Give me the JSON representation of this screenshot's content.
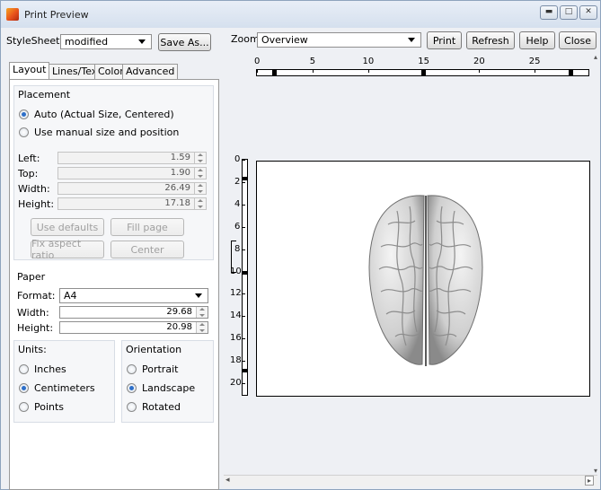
{
  "window": {
    "title": "Print Preview"
  },
  "toolbar": {
    "stylesheet_label": "StyleSheet",
    "stylesheet_value": "modified",
    "save_as": "Save As...",
    "zoom_label": "Zoom",
    "zoom_value": "Overview",
    "print": "Print",
    "refresh": "Refresh",
    "help": "Help",
    "close": "Close"
  },
  "tabs": [
    "Layout",
    "Lines/Text",
    "Color",
    "Advanced"
  ],
  "placement": {
    "title": "Placement",
    "auto_option": "Auto (Actual Size, Centered)",
    "manual_option": "Use manual size and position",
    "left_label": "Left:",
    "left_value": "1.59",
    "top_label": "Top:",
    "top_value": "1.90",
    "width_label": "Width:",
    "width_value": "26.49",
    "height_label": "Height:",
    "height_value": "17.18",
    "use_defaults": "Use defaults",
    "fill_page": "Fill page",
    "fix_aspect": "Fix aspect ratio",
    "center": "Center"
  },
  "paper": {
    "title": "Paper",
    "format_label": "Format:",
    "format_value": "A4",
    "width_label": "Width:",
    "width_value": "29.68",
    "height_label": "Height:",
    "height_value": "20.98"
  },
  "units": {
    "title": "Units:",
    "inches": "Inches",
    "centimeters": "Centimeters",
    "points": "Points",
    "selected": "Centimeters"
  },
  "orientation": {
    "title": "Orientation",
    "portrait": "Portrait",
    "landscape": "Landscape",
    "rotated": "Rotated",
    "selected": "Landscape"
  },
  "ruler": {
    "horizontal_ticks": [
      "0",
      "5",
      "10",
      "15",
      "20",
      "25"
    ],
    "vertical_ticks": [
      "0",
      "2",
      "4",
      "6",
      "8",
      "10",
      "12",
      "14",
      "16",
      "18",
      "20"
    ]
  },
  "colors": {
    "accent": "#2d6fc9",
    "page_background": "#ffffff",
    "brain_surface": "#d8d8d8"
  }
}
